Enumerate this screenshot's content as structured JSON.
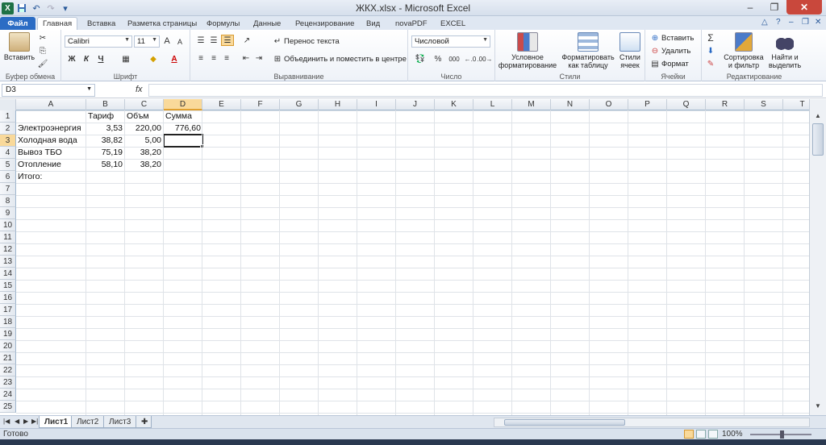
{
  "window": {
    "title": "ЖКХ.xlsx - Microsoft Excel"
  },
  "qat": {
    "app_icon": "excel-logo",
    "app_letter": "X",
    "items": [
      "save-icon",
      "undo-icon",
      "redo-icon",
      "customize-icon"
    ]
  },
  "tabs": [
    {
      "label": "Файл"
    },
    {
      "label": "Главная"
    },
    {
      "label": "Вставка"
    },
    {
      "label": "Разметка страницы"
    },
    {
      "label": "Формулы"
    },
    {
      "label": "Данные"
    },
    {
      "label": "Рецензирование"
    },
    {
      "label": "Вид"
    },
    {
      "label": "novaPDF"
    },
    {
      "label": "EXCEL"
    }
  ],
  "ribbon": {
    "clipboard": {
      "label": "Буфер обмена",
      "paste": "Вставить"
    },
    "font": {
      "label": "Шрифт",
      "name": "Calibri",
      "size": "11",
      "bold": "Ж",
      "italic": "К",
      "underline": "Ч",
      "grow": "A",
      "shrink": "A",
      "color_letter": "A"
    },
    "alignment": {
      "label": "Выравнивание",
      "wrap": "Перенос текста",
      "merge": "Объединить и поместить в центре"
    },
    "number": {
      "label": "Число",
      "format": "Числовой",
      "percent": "%",
      "thousands": "000"
    },
    "styles": {
      "label": "Стили",
      "conditional": "Условное форматирование",
      "as_table": "Форматировать как таблицу",
      "cell_styles": "Стили ячеек"
    },
    "cells": {
      "label": "Ячейки",
      "insert": "Вставить",
      "delete": "Удалить",
      "format": "Формат"
    },
    "editing": {
      "label": "Редактирование",
      "sort": "Сортировка и фильтр",
      "find": "Найти и выделить",
      "sum": "Σ"
    }
  },
  "formula_bar": {
    "name_box": "D3",
    "fx": "fx",
    "content": ""
  },
  "grid": {
    "columns": [
      "A",
      "B",
      "C",
      "D",
      "E",
      "F",
      "G",
      "H",
      "I",
      "J",
      "K",
      "L",
      "M",
      "N",
      "O",
      "P",
      "Q",
      "R",
      "S",
      "T"
    ],
    "rows": [
      "1",
      "2",
      "3",
      "4",
      "5",
      "6",
      "7",
      "8",
      "9",
      "10",
      "11",
      "12",
      "13",
      "14",
      "15",
      "16",
      "17",
      "18",
      "19",
      "20",
      "21",
      "22",
      "23",
      "24",
      "25"
    ],
    "active_cell": "D3",
    "headers": {
      "b1": "Тариф",
      "c1": "Объм",
      "d1": "Сумма"
    },
    "data": [
      {
        "label": "Электроэнергия",
        "tariff": "3,53",
        "volume": "220,00",
        "sum": "776,60"
      },
      {
        "label": "Холодная вода",
        "tariff": "38,82",
        "volume": "5,00",
        "sum": ""
      },
      {
        "label": "Вывоз ТБО",
        "tariff": "75,19",
        "volume": "38,20",
        "sum": ""
      },
      {
        "label": "Отопление",
        "tariff": "58,10",
        "volume": "38,20",
        "sum": ""
      }
    ],
    "total_label": "Итого:"
  },
  "sheets": [
    {
      "label": "Лист1"
    },
    {
      "label": "Лист2"
    },
    {
      "label": "Лист3"
    }
  ],
  "status": {
    "text": "Готово",
    "zoom": "100%"
  },
  "colors": {
    "accent": "#2b6cc4",
    "active_header": "#f9d99a",
    "excel_green": "#1e7145"
  }
}
